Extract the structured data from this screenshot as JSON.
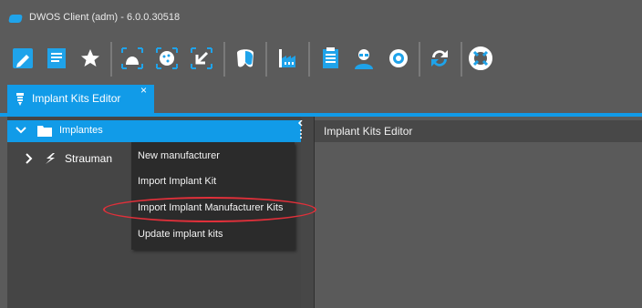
{
  "window": {
    "title": "DWOS Client (adm) - 6.0.0.30518"
  },
  "toolbar": {
    "icons": [
      "new-order-icon",
      "order-form-icon",
      "favorites-icon",
      "scan-jaw-icon",
      "implant-design-icon",
      "export-arrow-icon",
      "tooth-design-icon",
      "factory-icon",
      "clipboard-icon",
      "user-profile-icon",
      "settings-icon",
      "sync-icon",
      "help-lifebuoy-icon"
    ]
  },
  "tab": {
    "label": "Implant Kits Editor",
    "close": "×"
  },
  "tree": {
    "items": [
      {
        "label": "Implantes",
        "selected": true
      },
      {
        "label": "Strauman"
      }
    ]
  },
  "right_pane": {
    "title": "Implant Kits Editor"
  },
  "context_menu": {
    "items": [
      "New manufacturer",
      "Import Implant Kit",
      "Import Implant Manufacturer Kits",
      "Update implant kits"
    ]
  },
  "colors": {
    "accent": "#119be8",
    "highlight_ring": "#e0303a",
    "background": "#5b5b5b"
  }
}
